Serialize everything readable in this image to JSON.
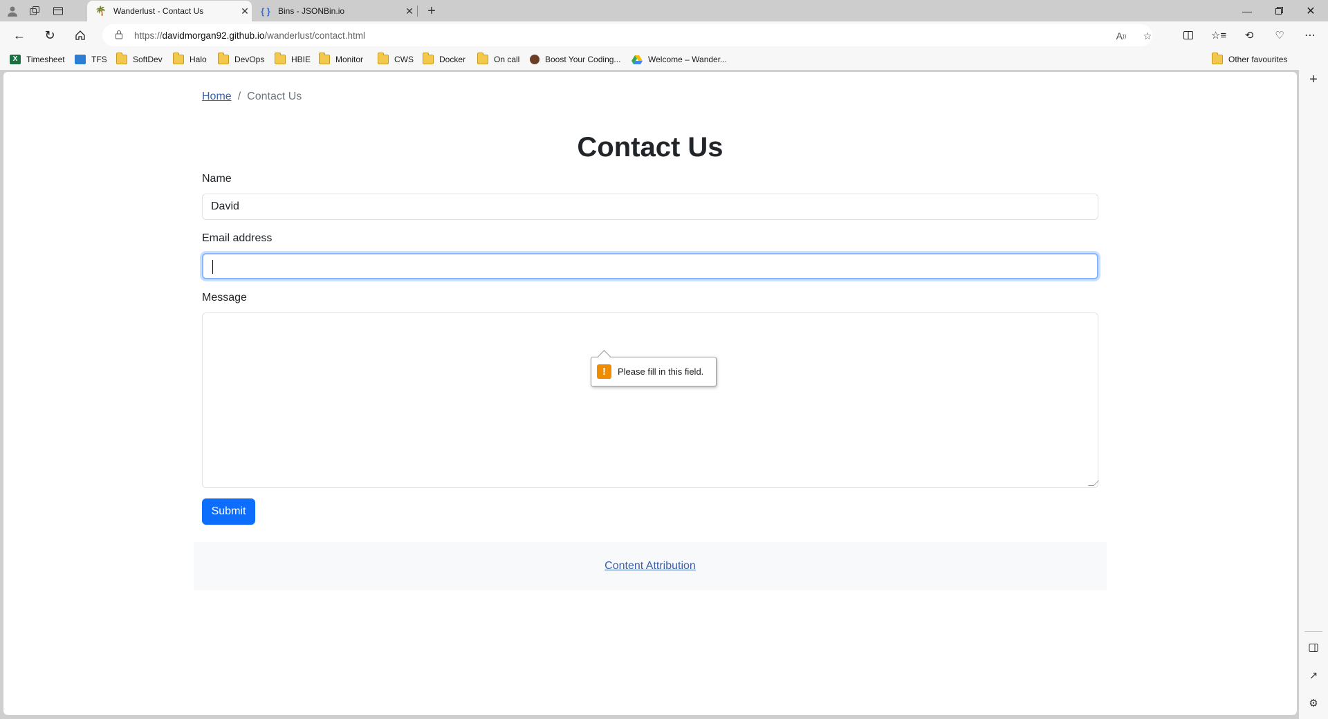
{
  "browser": {
    "tabs": [
      {
        "title": "Wanderlust - Contact Us",
        "active": true,
        "favicon": "palm-tree-icon"
      },
      {
        "title": "Bins - JSONBin.io",
        "active": false,
        "favicon": "curly-braces-icon"
      }
    ],
    "address": {
      "prefix": "https://",
      "host": "davidmorgan92.github.io",
      "path": "/wanderlust/contact.html"
    },
    "bookmarks": [
      {
        "label": "Timesheet",
        "icon": "excel-icon"
      },
      {
        "label": "TFS",
        "icon": "visual-studio-icon"
      },
      {
        "label": "SoftDev",
        "icon": "folder-icon"
      },
      {
        "label": "Halo",
        "icon": "folder-icon"
      },
      {
        "label": "DevOps",
        "icon": "folder-icon"
      },
      {
        "label": "HBIE",
        "icon": "folder-icon"
      },
      {
        "label": "Monitor",
        "icon": "folder-icon"
      },
      {
        "label": "CWS",
        "icon": "folder-icon"
      },
      {
        "label": "Docker",
        "icon": "folder-icon"
      },
      {
        "label": "On call",
        "icon": "folder-icon"
      },
      {
        "label": "Boost Your Coding...",
        "icon": "site-icon"
      },
      {
        "label": "Welcome – Wander...",
        "icon": "google-drive-icon"
      }
    ],
    "other_favourites": "Other favourites"
  },
  "page": {
    "breadcrumb": {
      "home": "Home",
      "separator": "/",
      "current": "Contact Us"
    },
    "title": "Contact Us",
    "form": {
      "name_label": "Name",
      "name_value": "David",
      "email_label": "Email address",
      "email_value": "",
      "message_label": "Message",
      "message_value": "",
      "submit_label": "Submit"
    },
    "validation_tooltip": "Please fill in this field.",
    "footer_link": "Content Attribution"
  },
  "colors": {
    "primary": "#0d6efd",
    "link": "#3a5fad",
    "focus_ring": "#86b7fe",
    "warning": "#f08c00"
  }
}
